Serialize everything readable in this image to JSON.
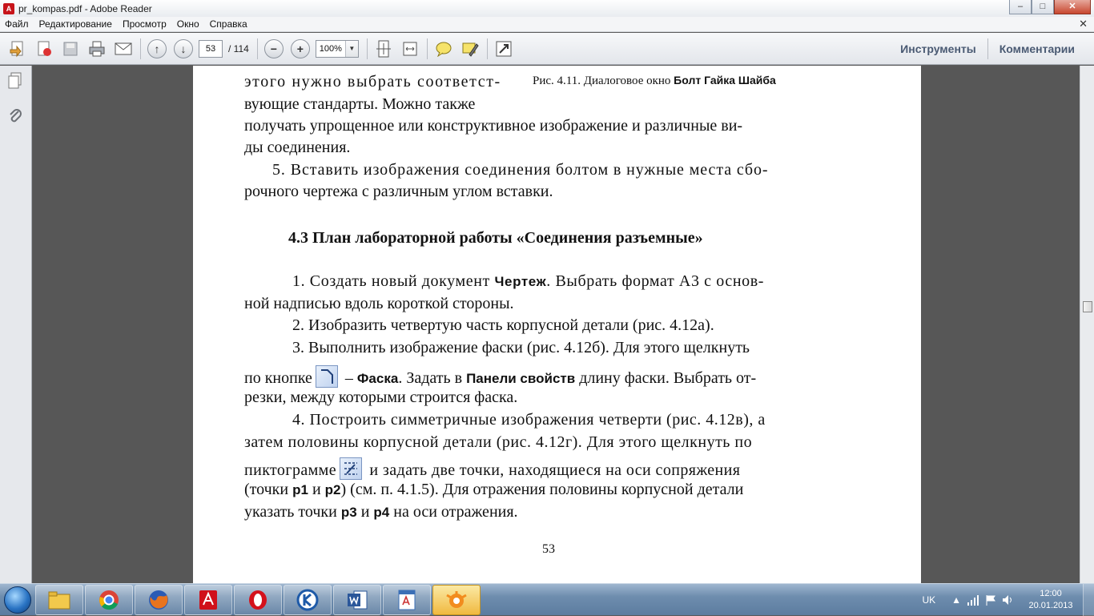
{
  "window": {
    "title": "pr_kompas.pdf - Adobe Reader",
    "controls": {
      "minimize": "–",
      "maximize": "□",
      "close": "✕"
    }
  },
  "menu": {
    "items": [
      "Файл",
      "Редактирование",
      "Просмотр",
      "Окно",
      "Справка"
    ],
    "close": "✕"
  },
  "toolbar": {
    "page_current": "53",
    "page_total": "/ 114",
    "zoom": "100%",
    "zoom_out": "−",
    "zoom_in": "+",
    "tools_label": "Инструменты",
    "comments_label": "Комментарии"
  },
  "document": {
    "caption_prefix": "Рис. 4.11. Диалоговое окно ",
    "caption_bold": "Болт Гайка Шайба",
    "lines_top": [
      "этого нужно выбрать соответст-",
      "вующие стандарты. Можно также",
      "получать упрощенное или конструктивное изображение и различные ви-",
      "ды соединения.",
      "5.  Вставить изображения соединения болтом в нужные места сбо-",
      "рочного чертежа с различным углом вставки."
    ],
    "heading": "4.3 План лабораторной работы «Соединения разъемные»",
    "p1_a": "1.  Создать новый документ ",
    "p1_b": "Чертеж",
    "p1_c": ". Выбрать формат А3 с основ-",
    "p1_line2": "ной надписью вдоль короткой стороны.",
    "p2": "2.  Изобразить четвертую часть корпусной детали (рис. 4.12а).",
    "p3_line1": "3.  Выполнить изображение фаски (рис. 4.12б). Для этого щелкнуть",
    "p3_a": "по кнопке",
    "p3_b": " – ",
    "p3_c": "Фаска",
    "p3_d": ". Задать в ",
    "p3_e": "Панели свойств",
    "p3_f": " длину фаски. Выбрать от-",
    "p3_line3": "резки, между которыми строится фаска.",
    "p4_line1": "4.  Построить симметричные изображения четверти (рис. 4.12в), а",
    "p4_line2": "затем половины корпусной детали (рис. 4.12г). Для этого щелкнуть  по",
    "p4_a": "пиктограмме",
    "p4_b": " и задать две точки, находящиеся на оси сопряжения",
    "p4_c": "(точки ",
    "p4_d": "p1",
    "p4_e": " и ",
    "p4_f": "p2",
    "p4_g": ") (см. п. 4.1.5). Для отражения половины корпусной детали",
    "p4_h": "указать точки ",
    "p4_i": "p3",
    "p4_j": " и ",
    "p4_k": "p4",
    "p4_l": " на оси отражения.",
    "page_number": "53"
  },
  "taskbar": {
    "apps": [
      "explorer-icon",
      "chrome-icon",
      "firefox-icon",
      "acrobat-icon",
      "opera-icon",
      "kompas-icon",
      "word-icon",
      "text-editor-icon",
      "avast-icon"
    ],
    "language": "UK",
    "time": "12:00",
    "date": "20.01.2013"
  }
}
